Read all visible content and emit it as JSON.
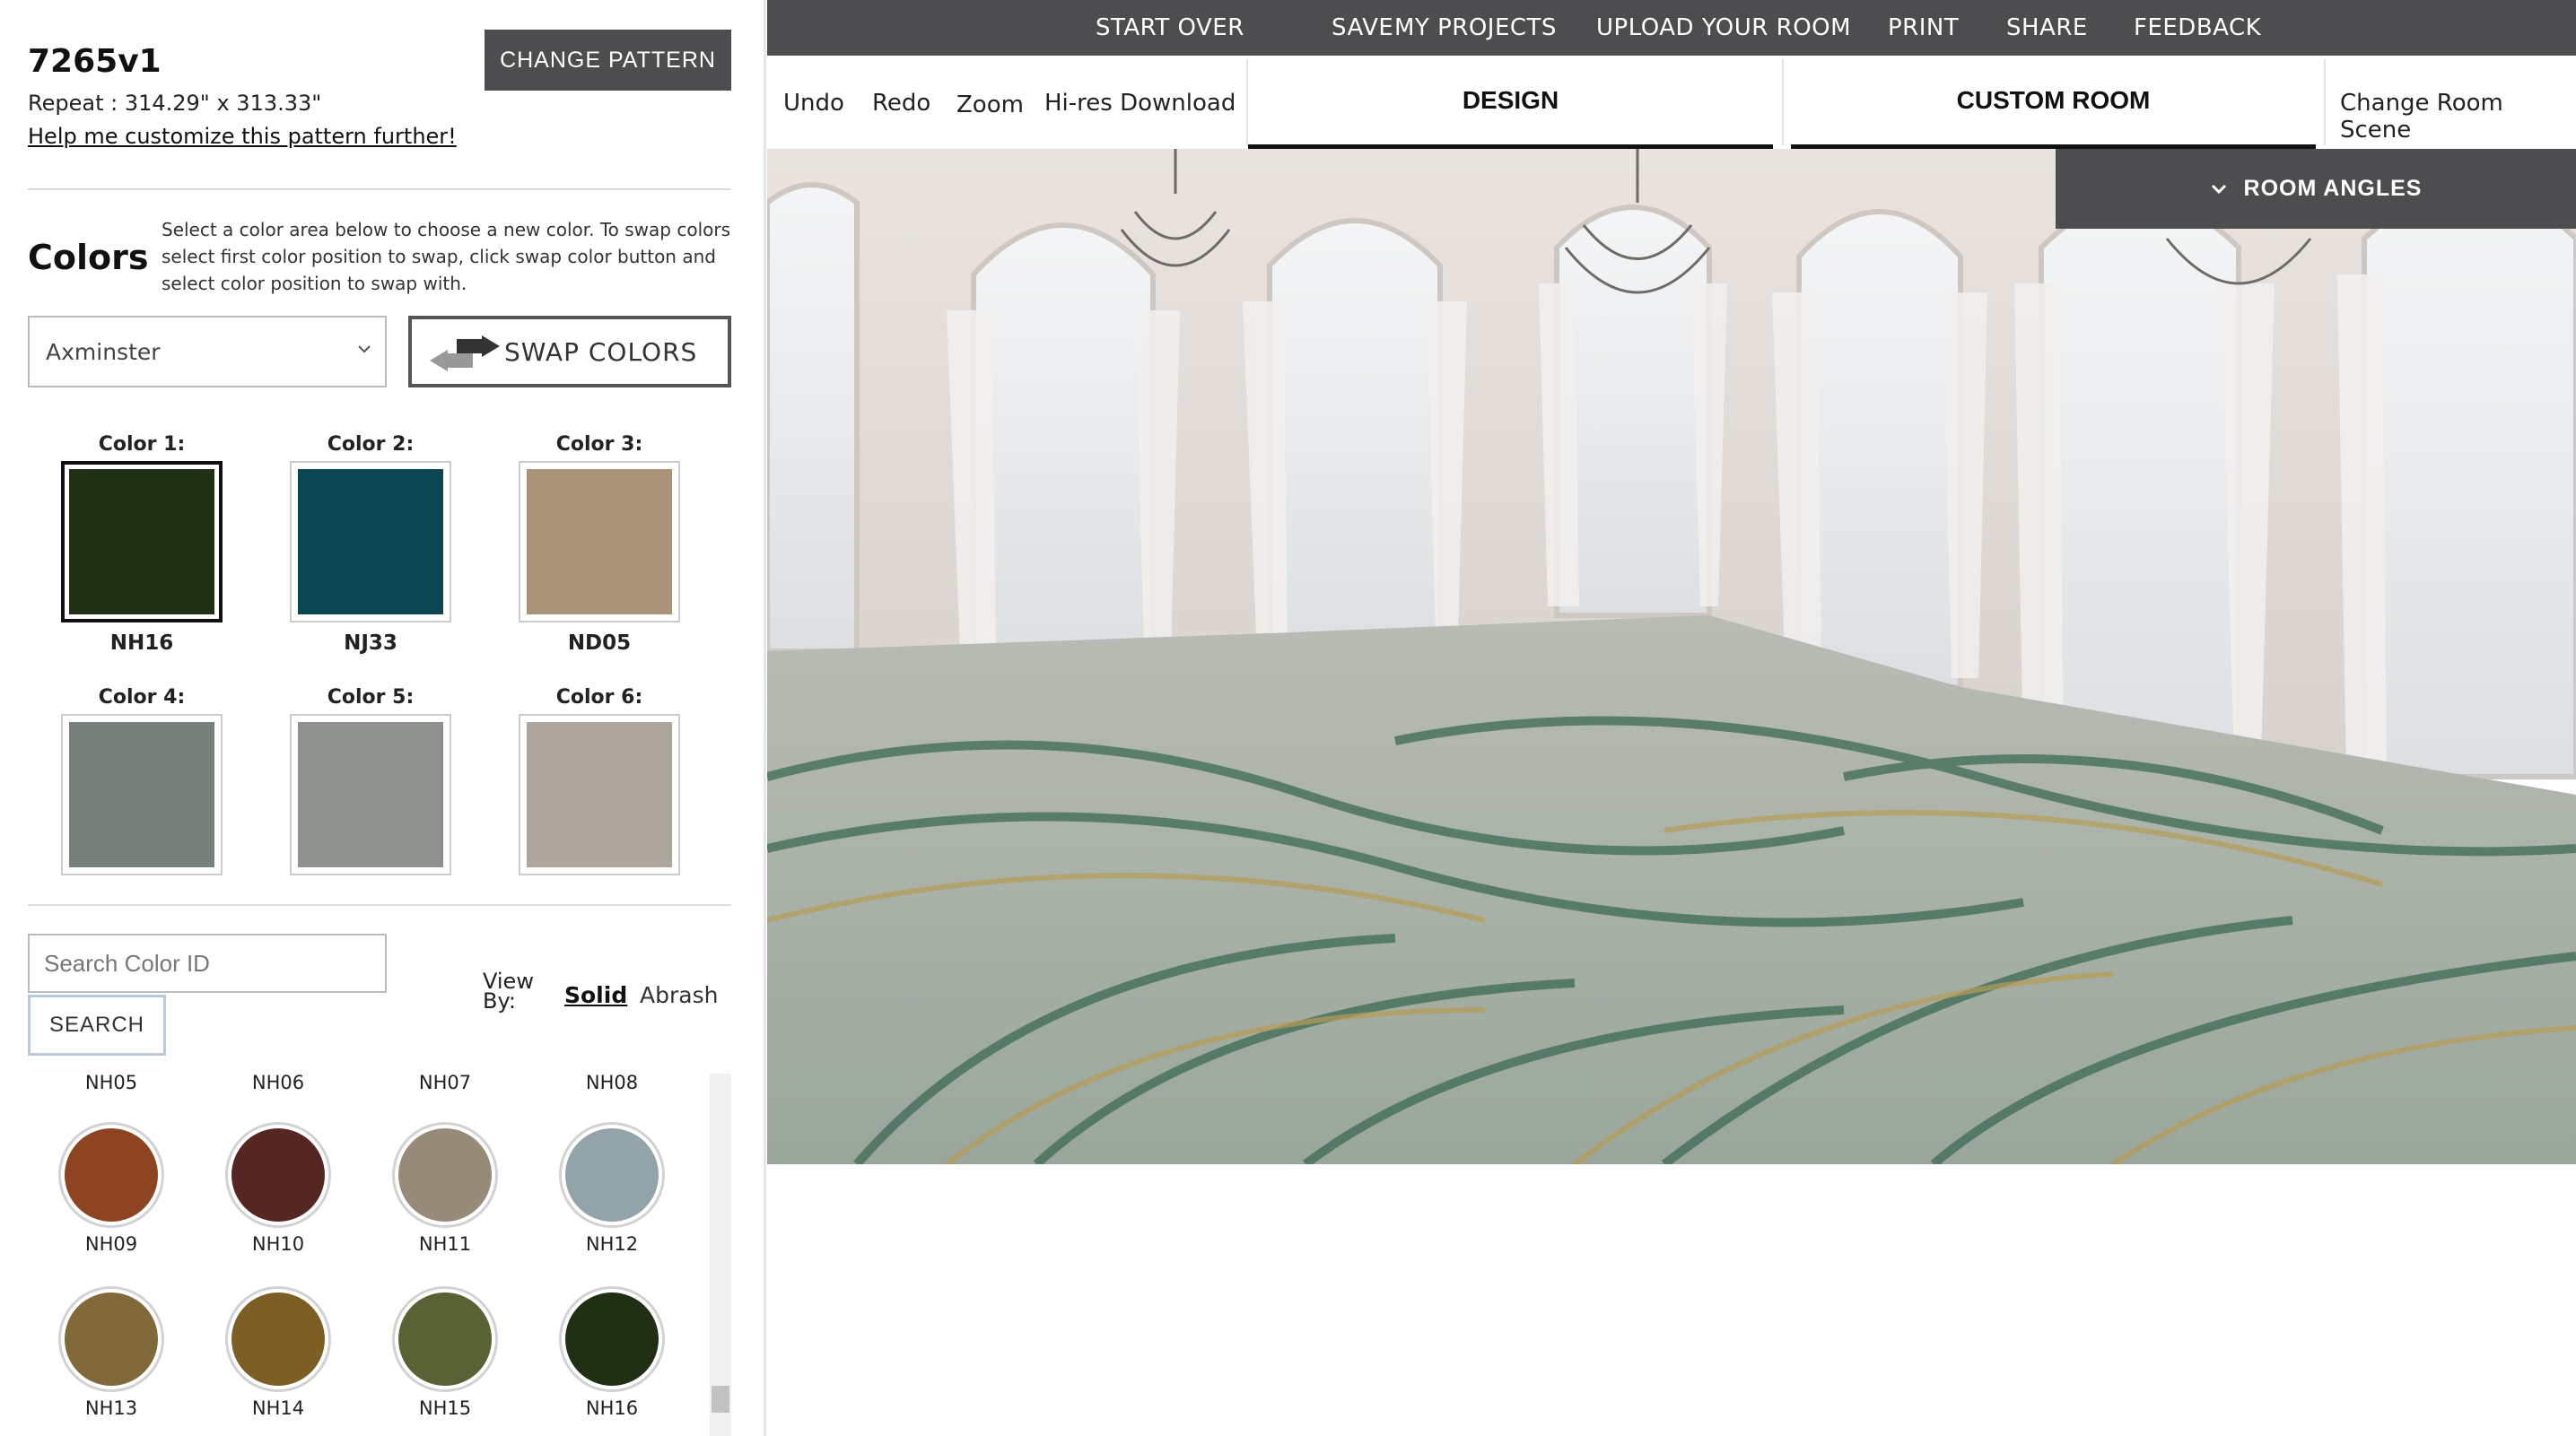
{
  "pattern": {
    "id": "7265v1",
    "repeat": "Repeat : 314.29\" x 313.33\"",
    "help_link": "Help me customize this pattern further!",
    "change_pattern_label": "CHANGE PATTERN"
  },
  "colors_section": {
    "title": "Colors",
    "help_text": "Select a color area below to choose a new color. To swap colors select first color position to swap, click swap color button and select color position to swap with.",
    "construction_selected": "Axminster",
    "swap_label": "SWAP COLORS",
    "swatches": [
      {
        "label": "Color 1:",
        "code": "NH16",
        "hex": "#213015",
        "active": true
      },
      {
        "label": "Color 2:",
        "code": "NJ33",
        "hex": "#0b4753",
        "active": false
      },
      {
        "label": "Color 3:",
        "code": "ND05",
        "hex": "#ab937a",
        "active": false
      },
      {
        "label": "Color 4:",
        "code": "",
        "hex": "#78807b",
        "active": false
      },
      {
        "label": "Color 5:",
        "code": "",
        "hex": "#8e918d",
        "active": false
      },
      {
        "label": "Color 6:",
        "code": "",
        "hex": "#aea69c",
        "active": false
      }
    ]
  },
  "color_search": {
    "placeholder": "Search Color ID",
    "button_label": "SEARCH",
    "view_by_label": "View By:",
    "view_solid": "Solid",
    "view_abrash": "Abrash"
  },
  "palette": {
    "top_row_codes": [
      "NH05",
      "NH06",
      "NH07",
      "NH08"
    ],
    "rows": [
      [
        {
          "code": "NH09",
          "hex": "#8d4421"
        },
        {
          "code": "NH10",
          "hex": "#562622"
        },
        {
          "code": "NH11",
          "hex": "#978a78"
        },
        {
          "code": "NH12",
          "hex": "#92a3a9"
        }
      ],
      [
        {
          "code": "NH13",
          "hex": "#82693a"
        },
        {
          "code": "NH14",
          "hex": "#7d5f26"
        },
        {
          "code": "NH15",
          "hex": "#586234"
        },
        {
          "code": "NH16",
          "hex": "#213015"
        }
      ]
    ]
  },
  "top_nav": [
    "START OVER",
    "SAVE",
    "MY PROJECTS",
    "UPLOAD YOUR ROOM",
    "PRINT",
    "SHARE",
    "FEEDBACK"
  ],
  "toolbar": {
    "undo": "Undo",
    "redo": "Redo",
    "zoom": "Zoom",
    "download": "Hi-res Download",
    "tab_design": "DESIGN",
    "tab_custom": "CUSTOM ROOM",
    "change_scene": "Change Room Scene"
  },
  "room": {
    "angles_label": "ROOM ANGLES"
  }
}
